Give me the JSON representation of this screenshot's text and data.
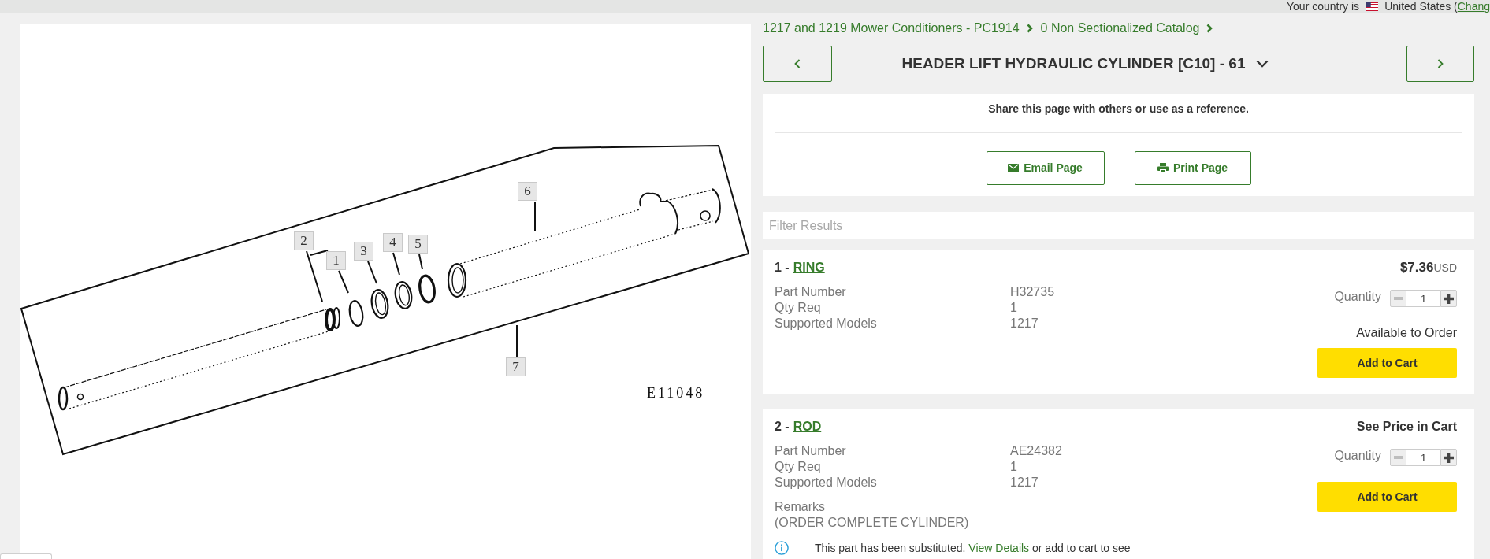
{
  "top_bar": {
    "label": "Your country is",
    "country": "United States (",
    "change_link": "Chang"
  },
  "diagram": {
    "callouts": [
      "1",
      "2",
      "3",
      "4",
      "5",
      "6",
      "7"
    ],
    "figure_code": "E11048"
  },
  "breadcrumbs": [
    {
      "label": "1217 and 1219 Mower Conditioners - PC1914"
    },
    {
      "label": "0 Non Sectionalized Catalog"
    }
  ],
  "page_title": "HEADER LIFT HYDRAULIC CYLINDER [C10] - 61",
  "share": {
    "text": "Share this page with others or use as a reference.",
    "buttons": [
      {
        "kind": "email",
        "label": "Email Page"
      },
      {
        "kind": "print",
        "label": "Print Page"
      }
    ]
  },
  "filter": {
    "placeholder": "Filter Results"
  },
  "parts": [
    {
      "number": "1 -",
      "name": "RING",
      "price": "$7.36",
      "currency": "USD",
      "details": [
        {
          "label": "Part Number",
          "value": "H32735"
        },
        {
          "label": "Qty Req",
          "value": "1"
        },
        {
          "label": "Supported Models",
          "value": "1217"
        }
      ],
      "quantity_label": "Quantity",
      "quantity": "1",
      "decrease_disabled": true,
      "availability": "Available to Order",
      "button": "Add to Cart"
    },
    {
      "number": "2 -",
      "name": "ROD",
      "price_note": "See Price in Cart",
      "details": [
        {
          "label": "Part Number",
          "value": "AE24382"
        },
        {
          "label": "Qty Req",
          "value": "1"
        },
        {
          "label": "Supported Models",
          "value": "1217"
        }
      ],
      "remarks_label": "Remarks",
      "remarks": "(ORDER COMPLETE CYLINDER)",
      "notice": {
        "before": "This part has been substituted.",
        "link": "View Details",
        "after": "or add to cart to see"
      },
      "quantity_label": "Quantity",
      "quantity": "1",
      "decrease_disabled": true,
      "button": "Add to Cart"
    }
  ]
}
